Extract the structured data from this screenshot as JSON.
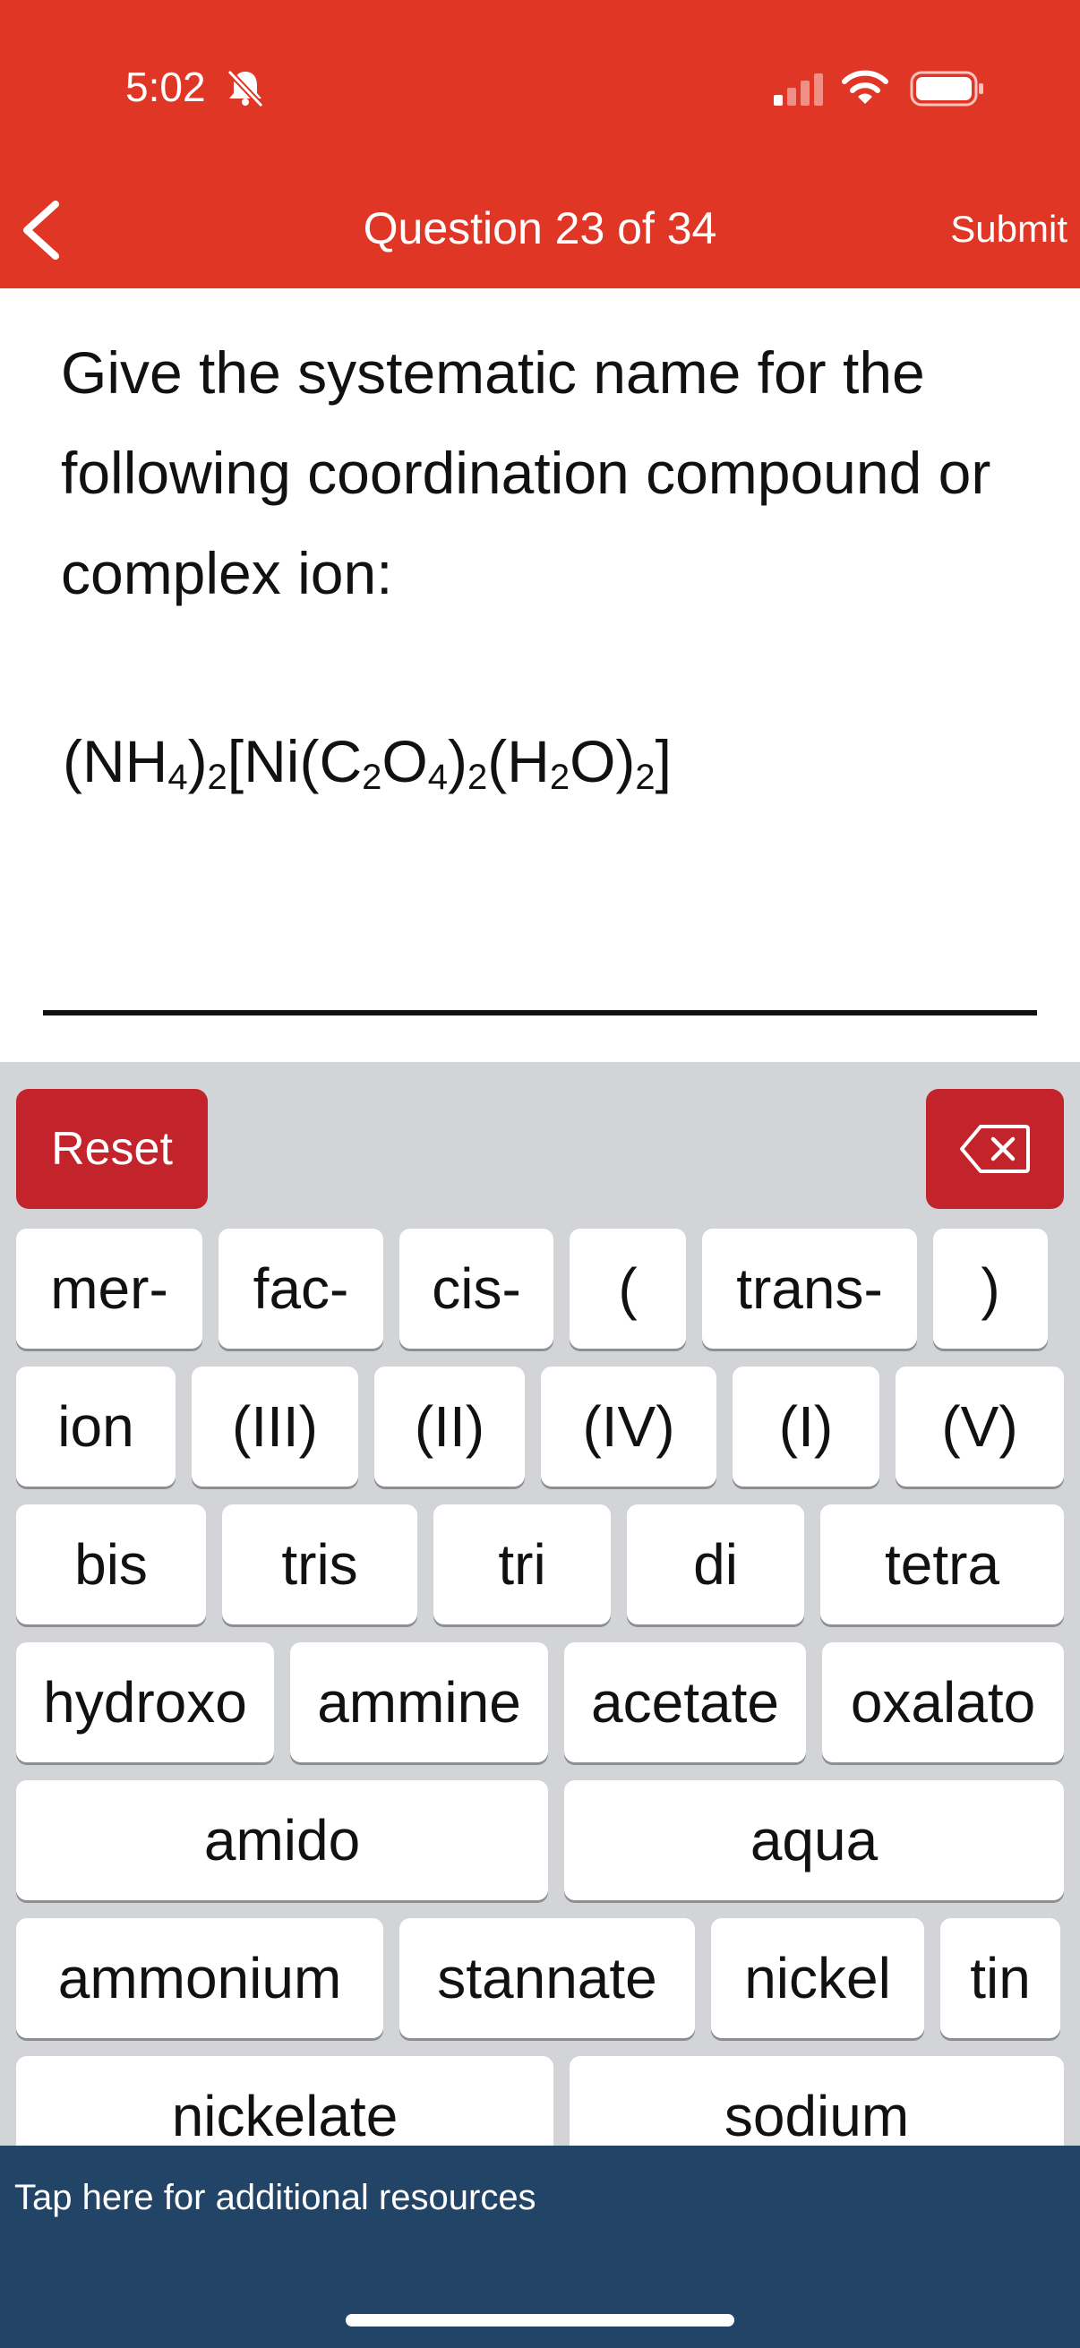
{
  "status_bar": {
    "time": "5:02"
  },
  "nav": {
    "title": "Question 23 of 34",
    "submit": "Submit"
  },
  "question": {
    "prompt": "Give the systematic name for the following coordination compound or complex ion:",
    "formula": {
      "p1": "(NH",
      "s1": "4",
      "p2": ")",
      "s2": "2",
      "p3": "[Ni(C",
      "s3": "2",
      "p4": "O",
      "s4": "4",
      "p5": ")",
      "s5": "2",
      "p6": "(H",
      "s6": "2",
      "p7": "O)",
      "s7": "2",
      "p8": "]"
    }
  },
  "keyboard": {
    "reset": "Reset",
    "rows": [
      [
        "mer-",
        "fac-",
        "cis-",
        "(",
        "trans-",
        ")"
      ],
      [
        "ion",
        "(III)",
        "(II)",
        "(IV)",
        "(I)",
        "(V)"
      ],
      [
        "bis",
        "tris",
        "tri",
        "di",
        "tetra"
      ],
      [
        "hydroxo",
        "ammine",
        "acetate",
        "oxalato"
      ],
      [
        "amido",
        "aqua"
      ],
      [
        "ammonium",
        "stannate",
        "nickel",
        "tin"
      ],
      [
        "nickelate",
        "sodium"
      ]
    ]
  },
  "footer": {
    "resources": "Tap here for additional resources"
  }
}
